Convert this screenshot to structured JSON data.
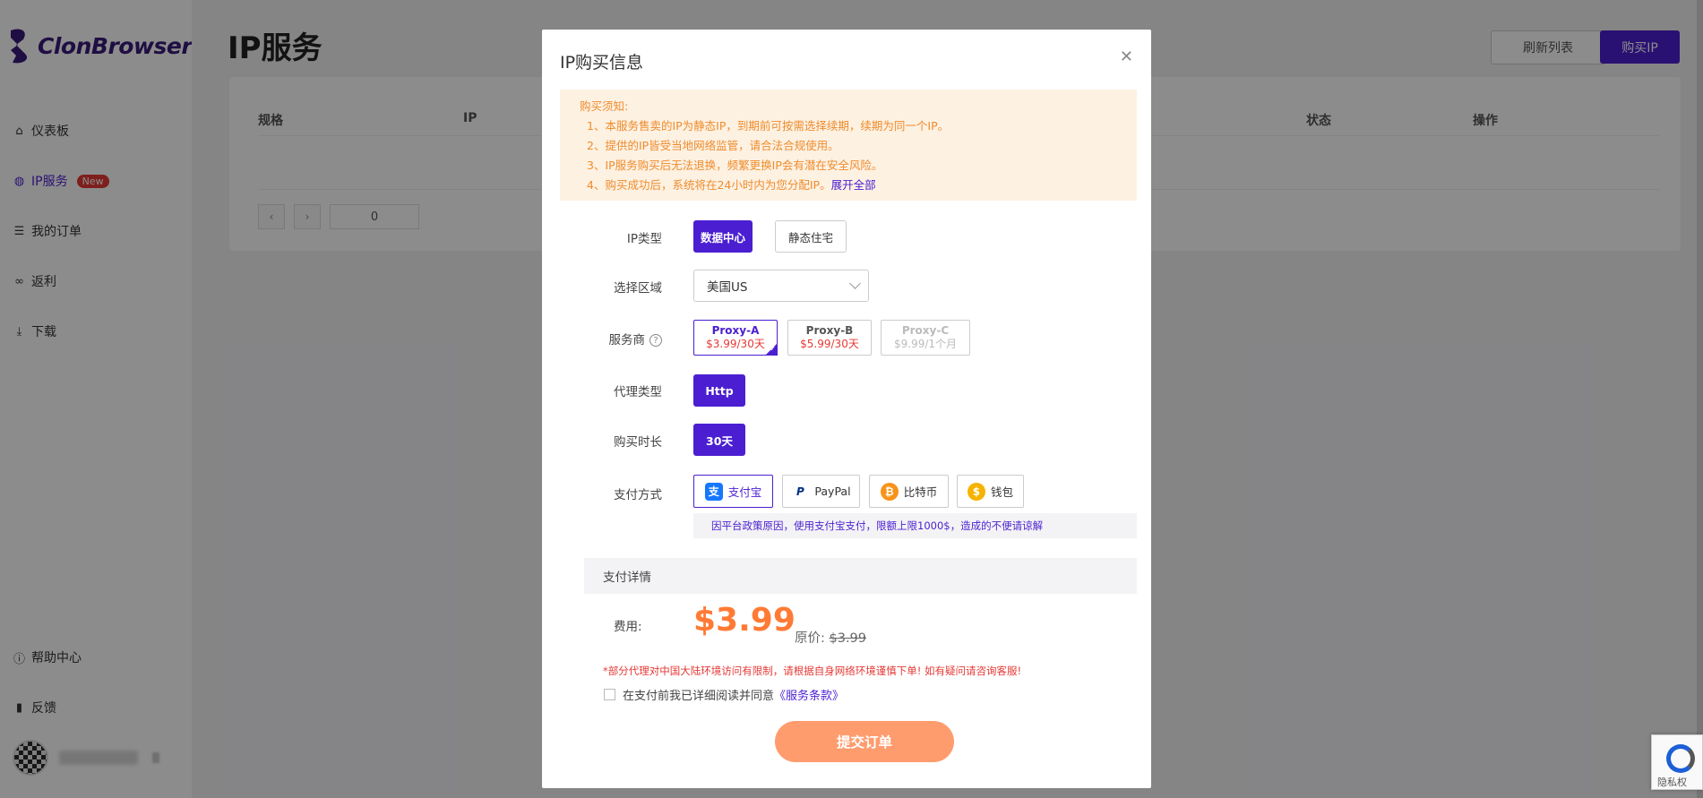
{
  "app": {
    "name": "ClonBrowser"
  },
  "sidebar": {
    "items": [
      {
        "label": "仪表板",
        "icon": "home-icon"
      },
      {
        "label": "IP服务",
        "icon": "globe-icon",
        "badge": "New"
      },
      {
        "label": "我的订单",
        "icon": "list-icon"
      },
      {
        "label": "返利",
        "icon": "link-icon"
      },
      {
        "label": "下载",
        "icon": "download-icon"
      }
    ],
    "bottom": [
      {
        "label": "帮助中心",
        "icon": "help-icon"
      },
      {
        "label": "反馈",
        "icon": "bookmark-icon"
      }
    ]
  },
  "page": {
    "title": "IP服务",
    "refresh_label": "刷新列表",
    "buy_label": "购买IP",
    "table_headers": [
      "规格",
      "IP",
      "状态",
      "操作"
    ],
    "pager_value": "0"
  },
  "modal": {
    "title": "IP购买信息",
    "notice": {
      "heading": "购买须知:",
      "lines": [
        "1、本服务售卖的IP为静态IP，到期前可按需选择续期，续期为同一个IP。",
        "2、提供的IP皆受当地网络监管，请合法合规使用。",
        "3、IP服务购买后无法退换，频繁更换IP会有潜在安全风险。",
        "4、购买成功后，系统将在24小时内为您分配IP。"
      ],
      "expand_link": "展开全部"
    },
    "labels": {
      "ip_type": "IP类型",
      "region": "选择区域",
      "provider": "服务商",
      "proxy_type": "代理类型",
      "duration": "购买时长",
      "payment": "支付方式"
    },
    "ip_types": [
      "数据中心",
      "静态住宅"
    ],
    "region_value": "美国US",
    "providers": [
      {
        "name": "Proxy-A",
        "price": "$3.99/30天"
      },
      {
        "name": "Proxy-B",
        "price": "$5.99/30天"
      },
      {
        "name": "Proxy-C",
        "price": "$9.99/1个月"
      }
    ],
    "proxy_type_value": "Http",
    "duration_value": "30天",
    "payments": [
      {
        "label": "支付宝",
        "icon": "alipay-icon"
      },
      {
        "label": "PayPal",
        "icon": "paypal-icon"
      },
      {
        "label": "比特币",
        "icon": "bitcoin-icon"
      },
      {
        "label": "钱包",
        "icon": "wallet-icon"
      }
    ],
    "payment_tip": "因平台政策原因，使用支付宝支付，限额上限1000$，造成的不便请谅解",
    "detail_title": "支付详情",
    "fee_label": "费用:",
    "price": "$3.99",
    "original_label": "原价:",
    "original_price": "$3.99",
    "warning": "*部分代理对中国大陆环境访问有限制，请根据自身网络环境谨慎下单! 如有疑问请咨询客服!",
    "agree_text": "在支付前我已详细阅读并同意",
    "terms_link": "《服务条款》",
    "submit_label": "提交订单"
  },
  "recaptcha": {
    "text": "隐私权"
  },
  "colors": {
    "accent": "#4b1fd1",
    "price": "#ff7b35",
    "submit": "#ff9c6e",
    "notice_bg": "#fdf1e2",
    "notice_text": "#ef8c2c",
    "warn": "#e53935"
  }
}
